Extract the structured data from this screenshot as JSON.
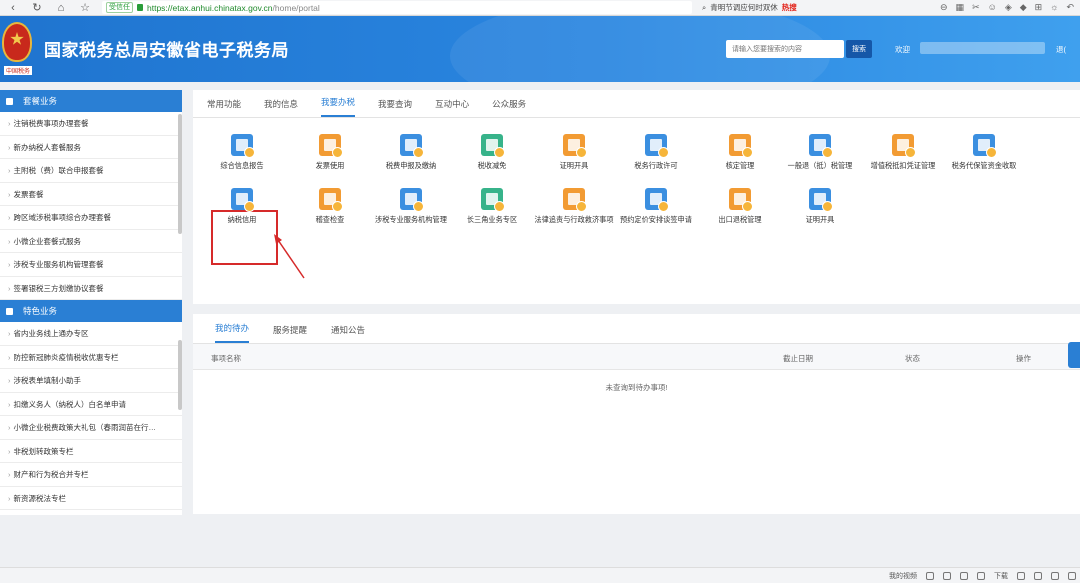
{
  "browser": {
    "secure_label": "受信任",
    "url_scheme": "https://",
    "url_host": "etax.anhui.chinatax.gov.cn",
    "url_path": "/home/portal",
    "search_query": "青明节调应何时双休",
    "hot_label": "热搜",
    "status_video": "我的视频",
    "status_download": "下载"
  },
  "header": {
    "emblem_text": "中国税务",
    "title": "国家税务总局安徽省电子税务局",
    "search_placeholder": "请输入您要搜索的内容",
    "search_button": "搜索",
    "welcome": "欢迎",
    "logout": "退("
  },
  "sidebar": {
    "section1_title": "套餐业务",
    "section1_items": [
      "注销税费事项办理套餐",
      "新办纳税人套餐服务",
      "主附税（费）联合申报套餐",
      "发票套餐",
      "跨区域涉税事项综合办理套餐",
      "小微企业套餐式服务",
      "涉税专业服务机构管理套餐",
      "签署银税三方划缴协议套餐"
    ],
    "section2_title": "特色业务",
    "section2_items": [
      "省内业务线上通办专区",
      "防控新冠肺炎疫情税收优惠专栏",
      "涉税表单填制小助手",
      "扣缴义务人（纳税人）白名单申请",
      "小微企业税费政策大礼包（春雨润苗在行…",
      "非税划转政策专栏",
      "财产和行为税合并专栏",
      "新资源税法专栏"
    ]
  },
  "main": {
    "tabs": [
      "常用功能",
      "我的信息",
      "我要办税",
      "我要查询",
      "互动中心",
      "公众服务"
    ],
    "active_tab": 2,
    "functions_row1": [
      {
        "label": "综合信息报告",
        "icon": "report-icon"
      },
      {
        "label": "发票使用",
        "icon": "invoice-icon"
      },
      {
        "label": "税费申报及缴纳",
        "icon": "tax-filing-icon"
      },
      {
        "label": "税收减免",
        "icon": "tax-reduction-icon"
      },
      {
        "label": "证明开具",
        "icon": "certificate-icon"
      },
      {
        "label": "税务行政许可",
        "icon": "license-icon"
      },
      {
        "label": "核定管理",
        "icon": "assessment-icon"
      },
      {
        "label": "一般退（抵）税管理",
        "icon": "refund-icon"
      },
      {
        "label": "增值税抵扣凭证管理",
        "icon": "vat-deduction-icon"
      },
      {
        "label": "税务代保管资金收取",
        "icon": "custody-fund-icon"
      }
    ],
    "functions_row2": [
      {
        "label": "纳税信用",
        "icon": "tax-credit-icon"
      },
      {
        "label": "稽查检查",
        "icon": "inspection-icon"
      },
      {
        "label": "涉税专业服务机构管理",
        "icon": "agency-icon"
      },
      {
        "label": "长三角业务专区",
        "icon": "yangtze-delta-icon"
      },
      {
        "label": "法律追责与行政救济事项",
        "icon": "legal-icon"
      },
      {
        "label": "预约定价安排谈签申请",
        "icon": "pricing-icon"
      },
      {
        "label": "出口退税管理",
        "icon": "export-refund-icon"
      },
      {
        "label": "证明开具",
        "icon": "certificate2-icon"
      }
    ]
  },
  "lower": {
    "tabs": [
      "我的待办",
      "服务提醒",
      "通知公告"
    ],
    "active_tab": 0,
    "columns": [
      "事项名称",
      "截止日期",
      "状态",
      "操作"
    ],
    "empty_message": "未查询到待办事项!"
  },
  "colors": {
    "brand_blue": "#2a7fd4",
    "highlight_red": "#d62a2a"
  }
}
